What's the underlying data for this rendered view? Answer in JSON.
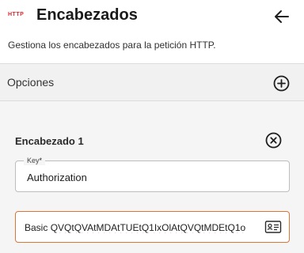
{
  "header": {
    "badge": "HTTP",
    "title": "Encabezados",
    "subtitle": "Gestiona los encabezados para la petición HTTP.",
    "back_icon": "arrow-left-icon"
  },
  "options": {
    "label": "Opciones",
    "add_icon": "plus-circle-icon"
  },
  "header_item": {
    "title": "Encabezado 1",
    "remove_icon": "close-circle-icon",
    "key_field": {
      "label": "Key",
      "required_mark": "*",
      "value": "Authorization"
    },
    "value_field": {
      "prefix": "Basic",
      "value": "QVQtQVAtMDAtTUEtQ1IxOlAtQVQtMDEtQ1o",
      "icon": "id-card-icon"
    }
  },
  "colors": {
    "badge": "#e0262f",
    "focus_border": "#d9773a",
    "options_bg": "#f1f1f1",
    "card_bg": "#f5f5f5"
  }
}
